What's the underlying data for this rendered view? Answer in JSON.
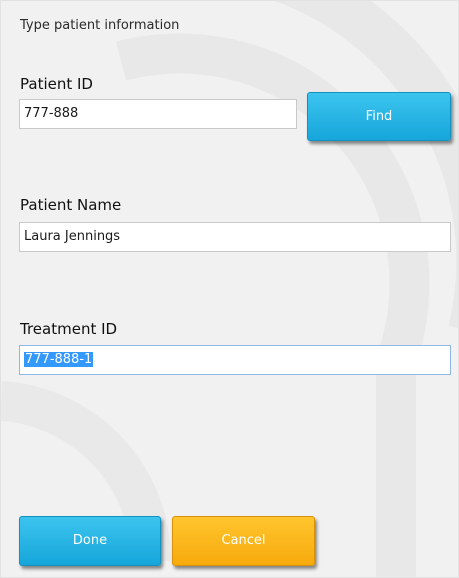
{
  "dialog": {
    "instruction": "Type patient information"
  },
  "patient_id": {
    "label": "Patient ID",
    "value": "777-888",
    "find_label": "Find"
  },
  "patient_name": {
    "label": "Patient Name",
    "value": "Laura Jennings"
  },
  "treatment_id": {
    "label": "Treatment ID",
    "value": "777-888-1"
  },
  "actions": {
    "done_label": "Done",
    "cancel_label": "Cancel"
  },
  "colors": {
    "primary_button": "#1aaee2",
    "secondary_button": "#f9b11a",
    "selection": "#3399ff",
    "panel_background": "#f1f1f1"
  }
}
